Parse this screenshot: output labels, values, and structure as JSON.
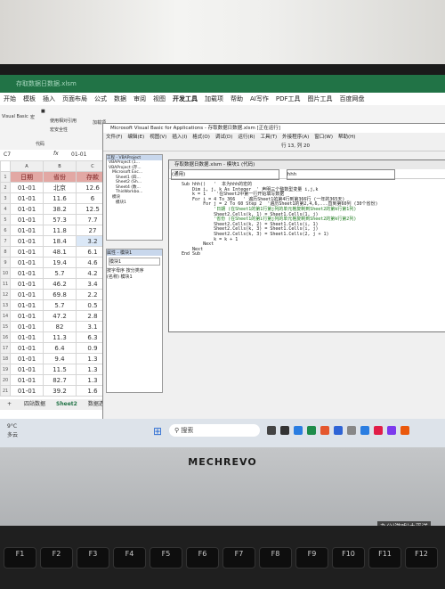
{
  "excel": {
    "title": "存取数据日数据.xlsm",
    "menu": [
      "开始",
      "模板",
      "插入",
      "页面布局",
      "公式",
      "数据",
      "审阅",
      "视图",
      "开发工具",
      "加载项",
      "帮助",
      "AI写作",
      "PDF工具",
      "图片工具",
      "百度网盘"
    ],
    "ribbon": {
      "vb_label": "Visual Basic",
      "macro_label": "宏",
      "relative_ref": "使用相对引用",
      "macro_security": "宏安全性",
      "group_code": "代码",
      "addin_label": "加载项"
    },
    "name_box": "C7",
    "formula_value": "01-01",
    "col_headers": [
      "A",
      "B",
      "C"
    ],
    "headers": [
      "日期",
      "省份",
      "存款"
    ],
    "rows": [
      [
        "01-01",
        "北京",
        "12.6"
      ],
      [
        "01-01",
        "11.6",
        "6"
      ],
      [
        "01-01",
        "38.2",
        "12.5"
      ],
      [
        "01-01",
        "57.3",
        "7.7"
      ],
      [
        "01-01",
        "11.8",
        "27"
      ],
      [
        "01-01",
        "18.4",
        "3.2"
      ],
      [
        "01-01",
        "48.1",
        "6.1"
      ],
      [
        "01-01",
        "19.4",
        "4.6"
      ],
      [
        "01-01",
        "5.7",
        "4.2"
      ],
      [
        "01-01",
        "46.2",
        "3.4"
      ],
      [
        "01-01",
        "69.8",
        "2.2"
      ],
      [
        "01-01",
        "5.7",
        "0.5"
      ],
      [
        "01-01",
        "47.2",
        "2.8"
      ],
      [
        "01-01",
        "82",
        "3.1"
      ],
      [
        "01-01",
        "11.3",
        "6.3"
      ],
      [
        "01-01",
        "6.4",
        "0.9"
      ],
      [
        "01-01",
        "9.4",
        "1.3"
      ],
      [
        "01-01",
        "11.5",
        "1.3"
      ],
      [
        "01-01",
        "82.7",
        "1.3"
      ],
      [
        "01-01",
        "39.2",
        "1.6"
      ]
    ],
    "row_numbers": [
      "1",
      "2",
      "3",
      "4",
      "5",
      "6",
      "7",
      "8",
      "9",
      "10",
      "11",
      "12",
      "13",
      "14",
      "15",
      "16",
      "17",
      "18",
      "19",
      "20",
      "21"
    ],
    "sheet_tabs": [
      "四站数据",
      "Sheet2",
      "数据透视表"
    ]
  },
  "vbe": {
    "title": "Microsoft Visual Basic for Applications - 存取数据日数据.xlsm [正在运行]",
    "menu": [
      "文件(F)",
      "编辑(E)",
      "视图(V)",
      "插入(I)",
      "格式(O)",
      "调试(D)",
      "运行(R)",
      "工具(T)",
      "外接程序(A)",
      "窗口(W)",
      "帮助(H)"
    ],
    "status": "行 13, 列 20",
    "project_title": "工程 - VBAProject",
    "project_items": [
      "VBAProject (1...",
      "VBAProject (存...",
      "Microsoft Exc...",
      "Sheet1 (四...",
      "Sheet2 (Sh...",
      "Sheet4 (数...",
      "ThisWorkbo...",
      "模块",
      "模块1"
    ],
    "props_title": "属性 - 模块1",
    "props_tabs": [
      "按字母序",
      "按分类序"
    ],
    "props_name": "(名称) 模块1",
    "code_title": "存取数据日数据.xlsm - 模块1 (代码)",
    "code_left": "(通用)",
    "code_right": "hhh",
    "code": [
      "Sub hhh()   '  本为hhh的宏的",
      "    Dim i, j, k As Integer  ' 声明三个整数型变量 i,j,k",
      "    k = 1    '在Sheet2中第一行开始填写数据",
      "    For i = 4 To 366   ' 遍历Sheet1的第4行到第366行 (一年的365天)",
      "        For j = 2 To 60 Step 2  '遍历Sheet1的第2,4,6,...直到第60列 (30个省份)",
      "            '日期 (在Sheet1的第1行第j列的单元格复制到Sheet2的第k行第1列)",
      "            Sheet2.Cells(k, 1) = Sheet1.Cells(1, j)",
      "            '省份 (在Sheet1的第i行第j列的单元格复制到Sheet2的第k行第2列)",
      "            Sheet2.Cells(k, 2) = Sheet1.Cells(i, 1)",
      "            Sheet2.Cells(k, 3) = Sheet1.Cells(i, j)",
      "            Sheet2.Cells(k, 3) = Sheet1.Cells(2, j + 1)",
      "            k = k + 1",
      "        Next",
      "    Next",
      "End Sub"
    ]
  },
  "taskbar": {
    "weather": "9°C",
    "weather_sub": "多云",
    "search": "搜索"
  },
  "laptop": {
    "brand": "MECHREVO",
    "sticker": "办公|游戏|太平洋"
  },
  "keys": [
    "F1",
    "F2",
    "F3",
    "F4",
    "F5",
    "F6",
    "F7",
    "F8",
    "F9",
    "F10",
    "F11",
    "F12"
  ]
}
